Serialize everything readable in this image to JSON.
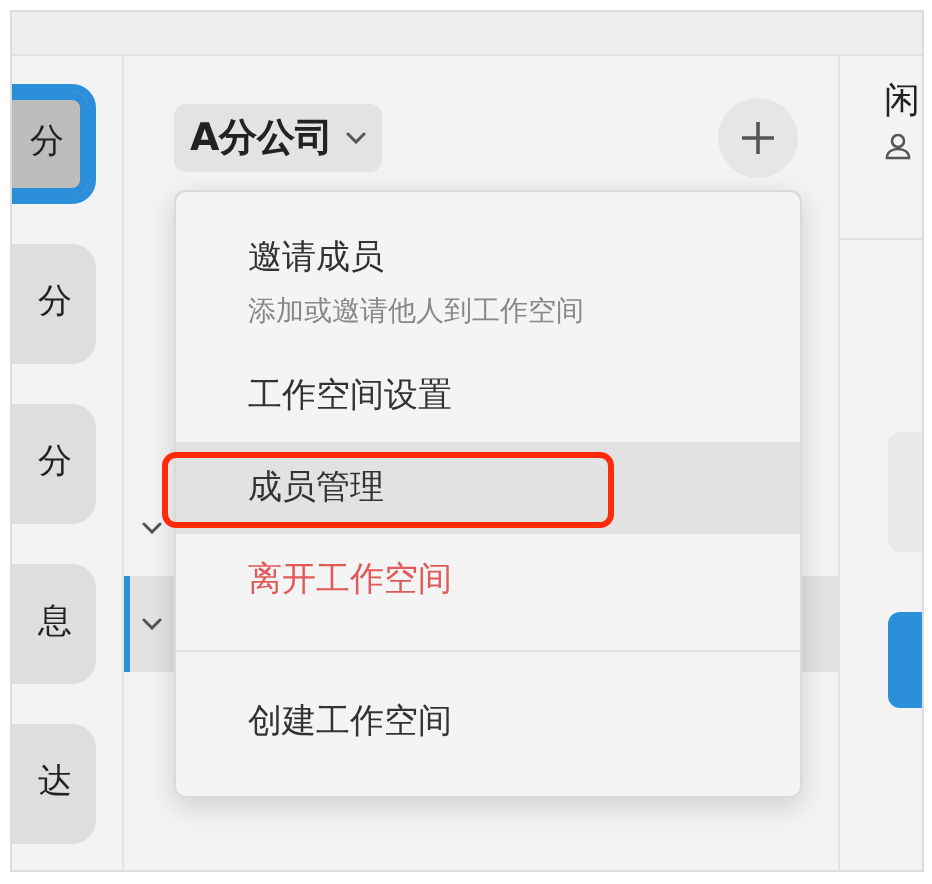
{
  "rail": {
    "items": [
      {
        "label": "分",
        "selected": true
      },
      {
        "label": "分",
        "selected": false
      },
      {
        "label": "分",
        "selected": false
      },
      {
        "label": "息",
        "selected": false
      },
      {
        "label": "达",
        "selected": false
      }
    ]
  },
  "workspace": {
    "name": "A分公司",
    "rows": [
      {
        "selected": false
      },
      {
        "selected": true
      }
    ]
  },
  "menu": {
    "items": [
      {
        "kind": "item",
        "label": "邀请成员",
        "subtitle": "添加或邀请他人到工作空间",
        "highlighted": false,
        "danger": false
      },
      {
        "kind": "item",
        "label": "工作空间设置",
        "highlighted": false,
        "danger": false
      },
      {
        "kind": "item",
        "label": "成员管理",
        "highlighted": true,
        "danger": false
      },
      {
        "kind": "item",
        "label": "离开工作空间",
        "highlighted": false,
        "danger": true
      },
      {
        "kind": "divider"
      },
      {
        "kind": "item",
        "label": "创建工作空间",
        "highlighted": false,
        "danger": false
      }
    ]
  },
  "detail": {
    "title": "闲"
  }
}
